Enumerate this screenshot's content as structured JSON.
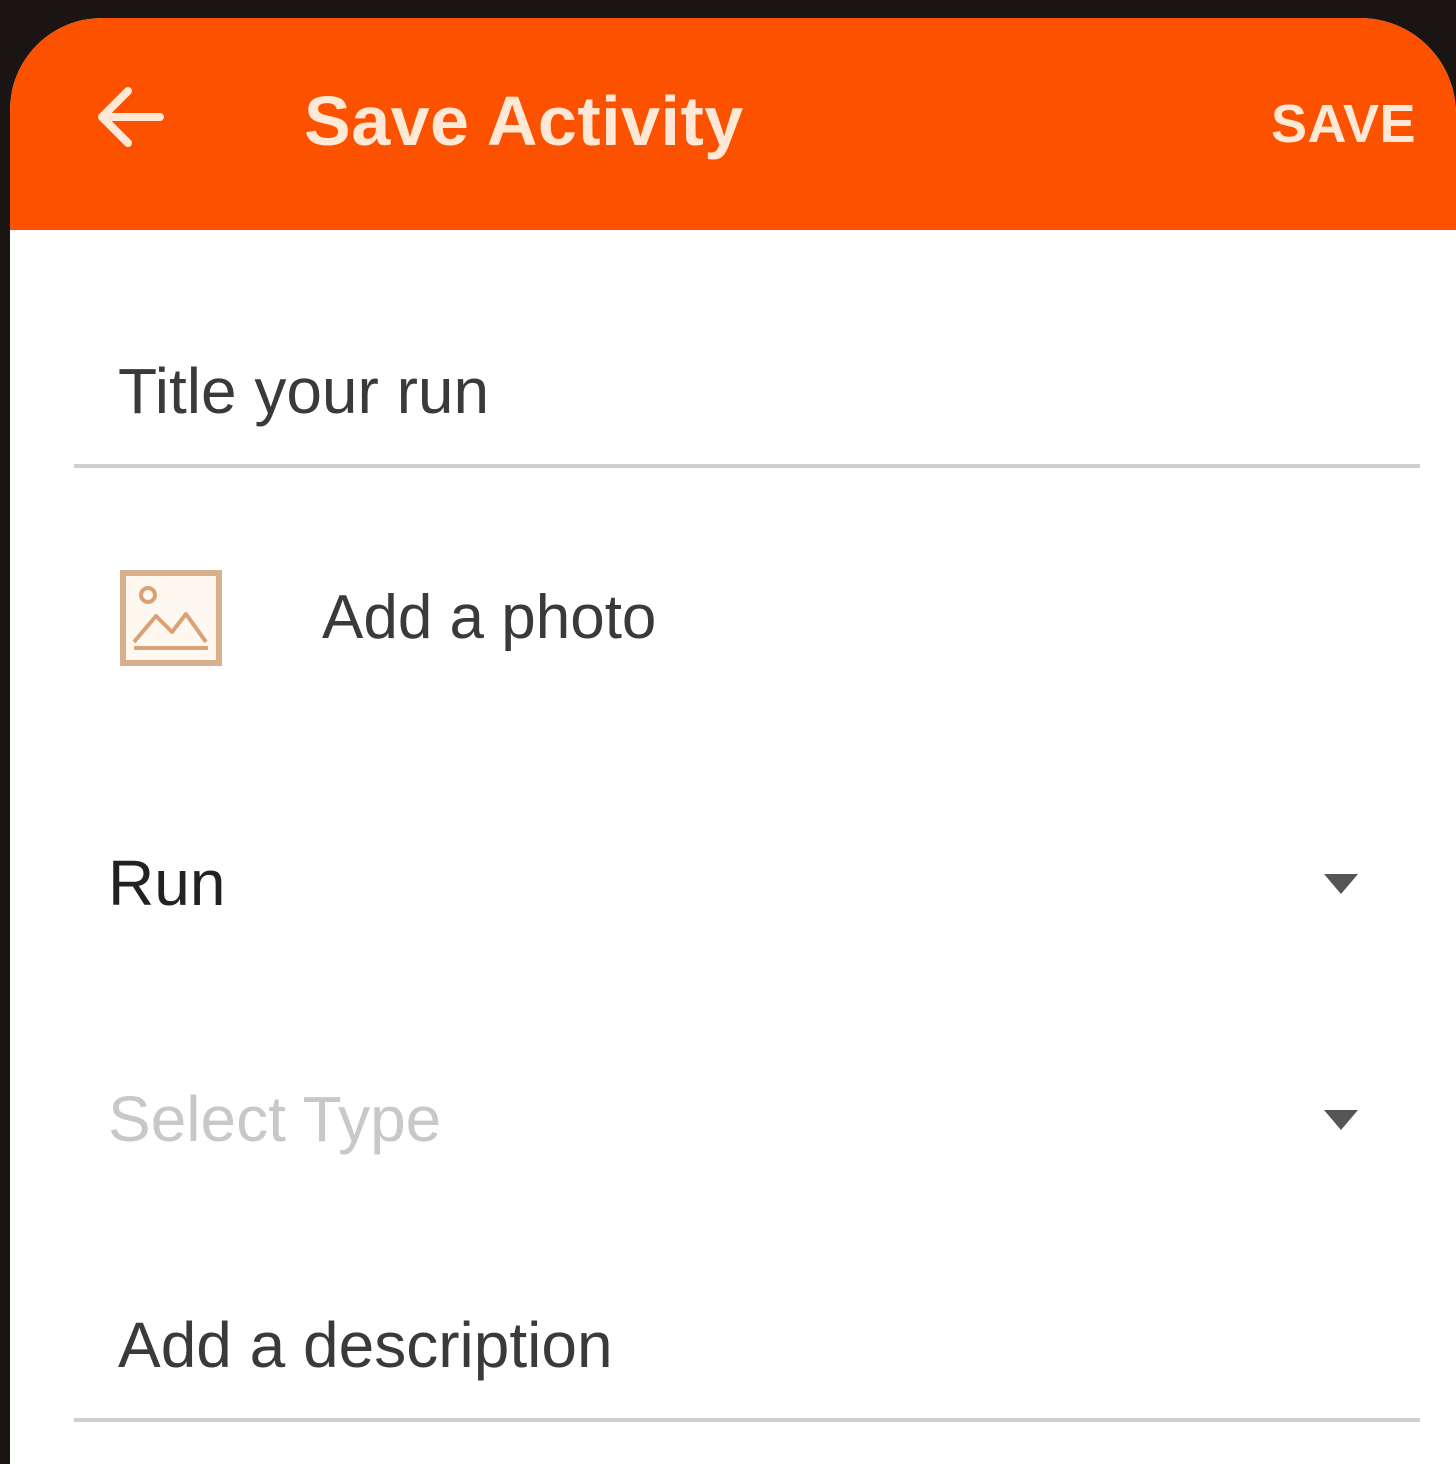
{
  "app_bar": {
    "title": "Save Activity",
    "save_label": "SAVE",
    "background_color": "#fc5200",
    "back_icon": "arrow-left-icon"
  },
  "form": {
    "title_field": {
      "value": "",
      "placeholder": "Title your run"
    },
    "photo": {
      "label": "Add a photo",
      "icon": "image-icon"
    },
    "activity_select": {
      "selected": "Run",
      "icon": "caret-down-icon"
    },
    "type_select": {
      "placeholder": "Select Type",
      "icon": "caret-down-icon"
    },
    "description_field": {
      "value": "",
      "placeholder": "Add a description"
    }
  }
}
